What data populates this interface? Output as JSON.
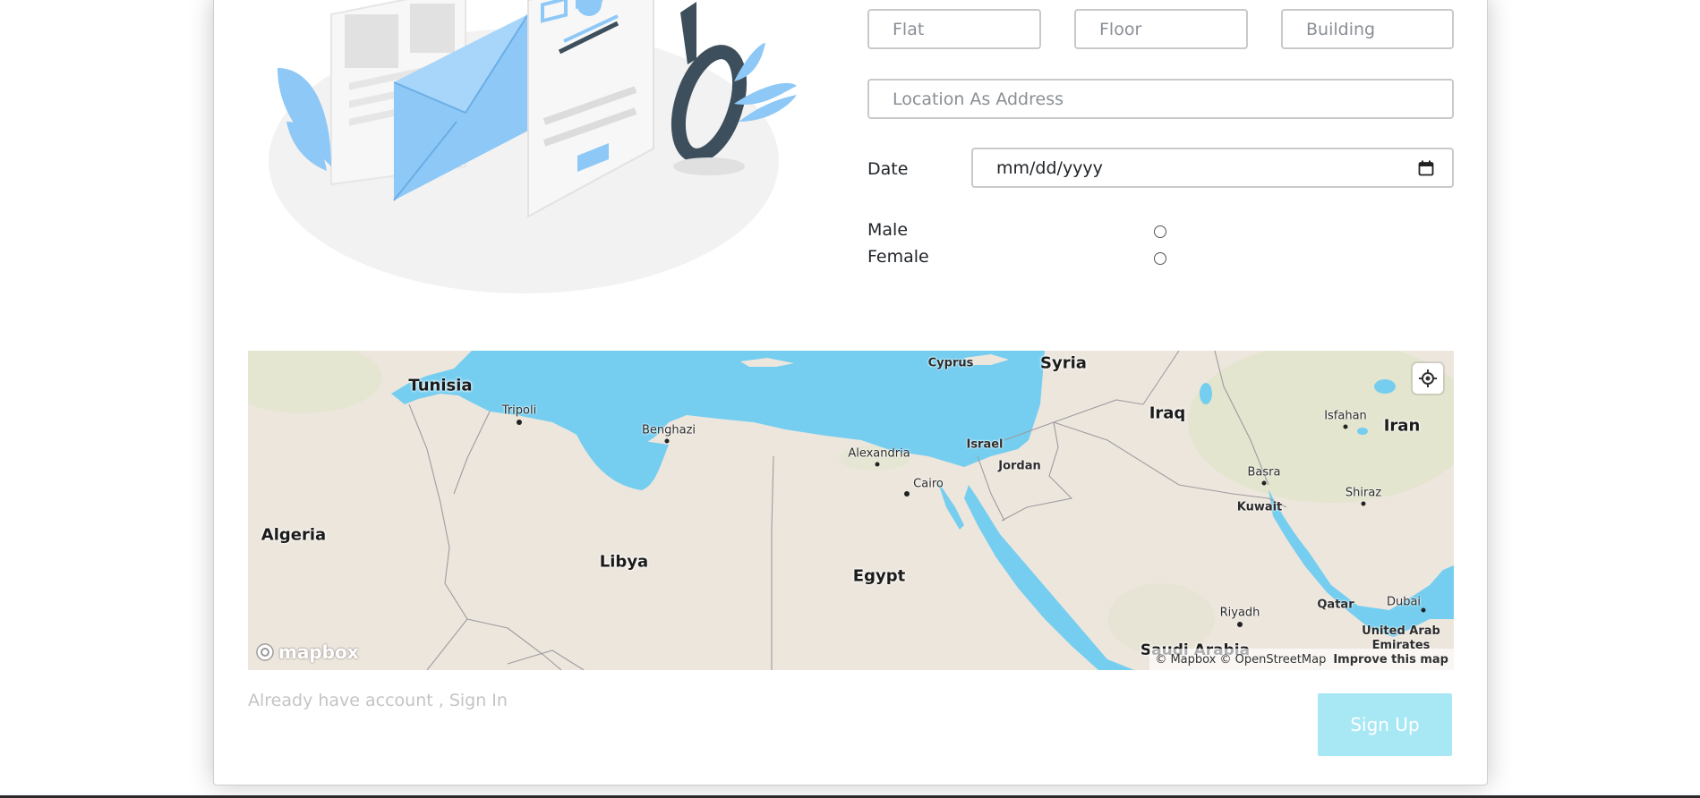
{
  "form": {
    "flat_placeholder": "Flat",
    "floor_placeholder": "Floor",
    "building_placeholder": "Building",
    "location_placeholder": "Location As Address",
    "date_label": "Date",
    "date_placeholder": "mm/dd/yyyy",
    "gender_options": [
      "Male",
      "Female"
    ]
  },
  "map": {
    "countries": [
      "Tunisia",
      "Syria",
      "Cyprus",
      "Iraq",
      "Iran",
      "Algeria",
      "Libya",
      "Egypt",
      "Israel",
      "Jordan",
      "Kuwait",
      "Qatar",
      "Saudi Arabia",
      "United Arab Emirates"
    ],
    "cities": [
      "Tripoli",
      "Benghazi",
      "Alexandria",
      "Cairo",
      "Isfahan",
      "Basra",
      "Shiraz",
      "Riyadh",
      "Dubai"
    ],
    "logo": "mapbox",
    "attribution_mapbox": "© Mapbox",
    "attribution_osm": "© OpenStreetMap",
    "improve_link": "Improve this map",
    "water_color": "#75cef0",
    "land_color": "#ede6dd"
  },
  "footer": {
    "signin_text": "Already have account , Sign In",
    "signup_label": "Sign Up"
  },
  "colors": {
    "accent": "#a8e8f4",
    "illustration_blue": "#8ec8f6"
  }
}
